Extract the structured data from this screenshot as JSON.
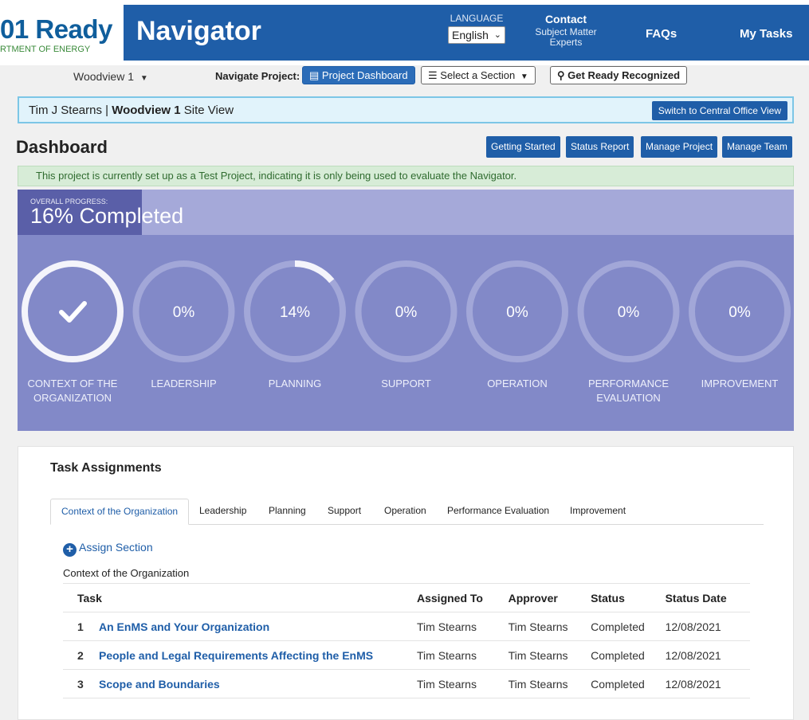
{
  "header": {
    "logo_text": "01 Ready",
    "logo_sub": "RTMENT OF ENERGY",
    "app_title": "Navigator",
    "language_label": "LANGUAGE",
    "language_value": "English",
    "contact_title": "Contact",
    "contact_sub": "Subject Matter Experts",
    "faqs": "FAQs",
    "my_tasks": "My Tasks"
  },
  "subnav": {
    "site": "Woodview 1",
    "navigate_label": "Navigate Project:",
    "project_dashboard": "Project Dashboard",
    "select_section": "Select a Section",
    "get_recognized": "Get Ready Recognized"
  },
  "siteview": {
    "user": "Tim J Stearns |",
    "site": "Woodview 1",
    "suffix": "Site View",
    "switch_button": "Switch to Central Office View"
  },
  "dashboard": {
    "title": "Dashboard",
    "buttons": [
      "Getting Started",
      "Status Report",
      "Manage Project",
      "Manage Team"
    ],
    "notice": "This project is currently set up as a Test Project, indicating it is only being used to evaluate the Navigator."
  },
  "progress": {
    "overall_label": "OVERALL PROGRESS:",
    "overall_value": "16% Completed",
    "overall_fraction": 0.16,
    "sections": [
      {
        "name": "CONTEXT OF THE ORGANIZATION",
        "value": "",
        "fraction": 1.0,
        "complete": true
      },
      {
        "name": "LEADERSHIP",
        "value": "0%",
        "fraction": 0.0,
        "complete": false
      },
      {
        "name": "PLANNING",
        "value": "14%",
        "fraction": 0.14,
        "complete": false
      },
      {
        "name": "SUPPORT",
        "value": "0%",
        "fraction": 0.0,
        "complete": false
      },
      {
        "name": "OPERATION",
        "value": "0%",
        "fraction": 0.0,
        "complete": false
      },
      {
        "name": "PERFORMANCE EVALUATION",
        "value": "0%",
        "fraction": 0.0,
        "complete": false
      },
      {
        "name": "IMPROVEMENT",
        "value": "0%",
        "fraction": 0.0,
        "complete": false
      }
    ]
  },
  "tasks": {
    "title": "Task Assignments",
    "tabs": [
      "Context of the Organization",
      "Leadership",
      "Planning",
      "Support",
      "Operation",
      "Performance Evaluation",
      "Improvement"
    ],
    "assign_label": "Assign Section",
    "section_name": "Context of the Organization",
    "columns": [
      "Task",
      "Assigned To",
      "Approver",
      "Status",
      "Status Date"
    ],
    "rows": [
      {
        "num": "1",
        "task": "An EnMS and Your Organization",
        "assigned_to": "Tim Stearns",
        "approver": "Tim Stearns",
        "status": "Completed",
        "date": "12/08/2021"
      },
      {
        "num": "2",
        "task": "People and Legal Requirements Affecting the EnMS",
        "assigned_to": "Tim Stearns",
        "approver": "Tim Stearns",
        "status": "Completed",
        "date": "12/08/2021"
      },
      {
        "num": "3",
        "task": "Scope and Boundaries",
        "assigned_to": "Tim Stearns",
        "approver": "Tim Stearns",
        "status": "Completed",
        "date": "12/08/2021"
      }
    ]
  }
}
